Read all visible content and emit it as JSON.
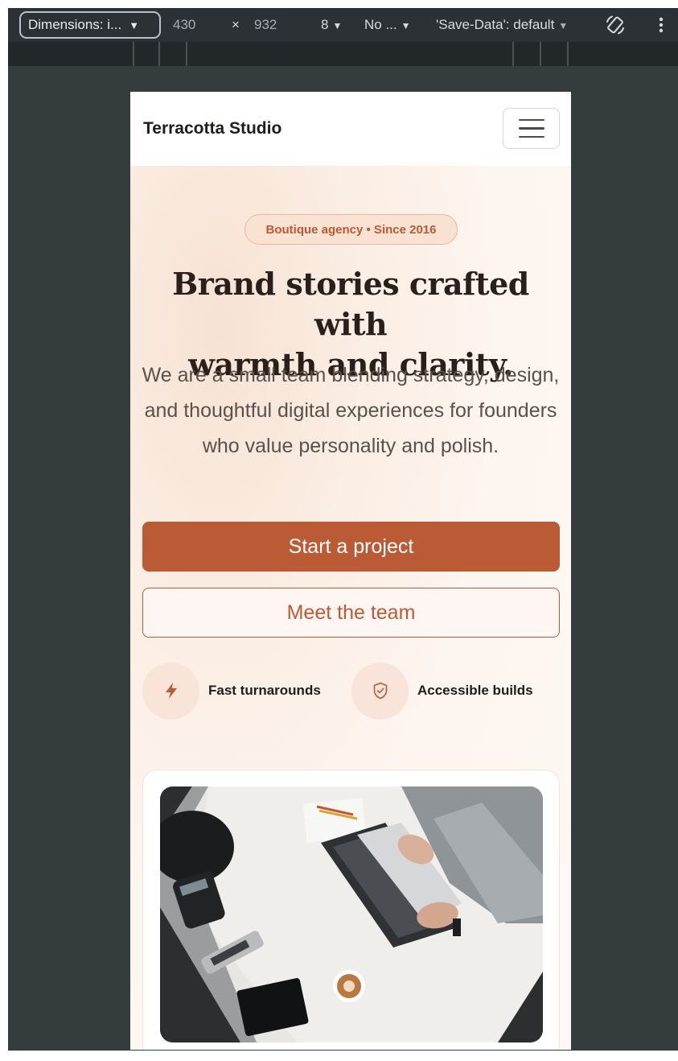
{
  "devtools": {
    "dimensions_label": "Dimensions: i...",
    "width": "430",
    "times": "×",
    "height": "932",
    "zoom": "8",
    "throttle": "No ...",
    "save_data": "'Save-Data': default"
  },
  "site": {
    "brand": "Terracotta Studio",
    "badge": "Boutique agency • Since 2016",
    "headline_line1": "Brand stories crafted with",
    "headline_line2": "warmth and clarity.",
    "subtext": "We are a small team blending strategy, design, and thoughtful digital experiences for founders who value personality and polish.",
    "primary_cta": "Start a project",
    "secondary_cta": "Meet the team",
    "features": [
      {
        "label": "Fast turnarounds",
        "icon": "lightning-icon"
      },
      {
        "label": "Accessible builds",
        "icon": "shield-check-icon"
      }
    ]
  },
  "colors": {
    "accent": "#bb5b36",
    "badge_bg": "#f9e2d2",
    "feature_circle": "#f8e4d8",
    "heading": "#2a201b",
    "devtools_bg": "#2b3134"
  }
}
